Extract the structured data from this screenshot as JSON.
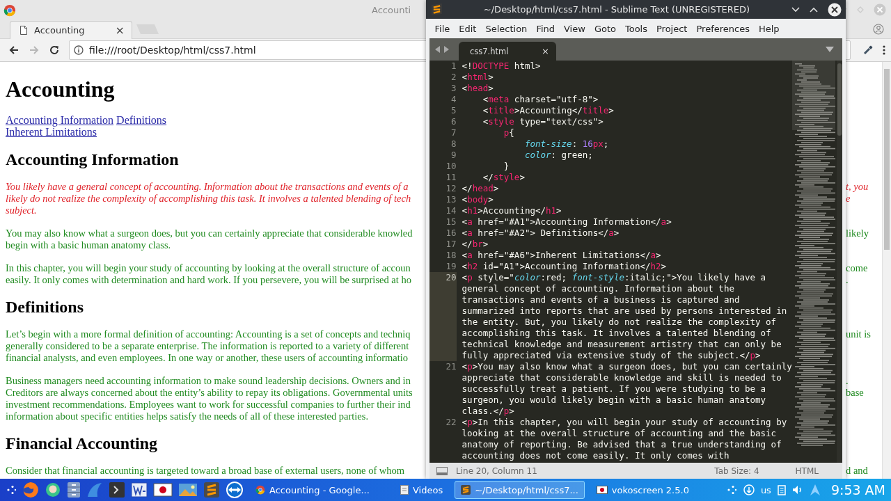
{
  "browser": {
    "window_title": "Accounti",
    "tab": {
      "label": "Accounting",
      "close": "×"
    },
    "nav": [
      {
        "kind": "back",
        "disabled": false
      },
      {
        "kind": "forward",
        "disabled": true
      },
      {
        "kind": "reload",
        "disabled": false
      }
    ],
    "address": "file:///root/Desktop/html/css7.html",
    "page": [
      {
        "kind": "h1",
        "lines": [
          {
            "left": "Accounting"
          }
        ]
      },
      {
        "kind": "links",
        "lines": [
          {
            "links": [
              "Accounting Information",
              "Definitions"
            ]
          },
          {
            "links": [
              "Inherent Limitations"
            ]
          }
        ]
      },
      {
        "kind": "h2",
        "lines": [
          {
            "left": "Accounting Information"
          }
        ]
      },
      {
        "kind": "p-red",
        "lines": [
          {
            "left": "You likely have a general concept of accounting. Information about the transactions and events of a",
            "right": "t, you"
          },
          {
            "left": "likely do not realize the complexity of accomplishing this task. It involves a talented blending of tech",
            "right": "e"
          },
          {
            "left": "subject."
          }
        ]
      },
      {
        "kind": "p-green",
        "lines": [
          {
            "left": "You may also know what a surgeon does, but you can certainly appreciate that considerable knowled",
            "right": "likely"
          },
          {
            "left": "begin with a basic human anatomy class."
          }
        ]
      },
      {
        "kind": "p-green",
        "lines": [
          {
            "left": "In this chapter, you will begin your study of accounting by looking at the overall structure of accoun",
            "right": "come"
          },
          {
            "left": "easily. It only comes with determination and hard work. If you persevere, you will be surprised at ho",
            "right": "."
          }
        ]
      },
      {
        "kind": "h2",
        "lines": [
          {
            "left": "Definitions"
          }
        ]
      },
      {
        "kind": "p-green",
        "lines": [
          {
            "left": "Let’s begin with a more formal definition of accounting: Accounting is a set of concepts and techniq",
            "right": "unit is"
          },
          {
            "left": "generally considered to be a separate enterprise. The information is reported to a variety of different"
          },
          {
            "left": "financial analysts, and even employees. In one way or another, these users of accounting informatio"
          }
        ]
      },
      {
        "kind": "p-green",
        "lines": [
          {
            "left": "Business managers need accounting information to make sound leadership decisions. Owners and in",
            "right": "."
          },
          {
            "left": "Creditors are always concerned about the entity’s ability to repay its obligations. Governmental units",
            "right": "base"
          },
          {
            "left": "investment recommendations. Employees want to work for successful companies to further their ind"
          },
          {
            "left": "information about specific entities helps satisfy the needs of all of these interested parties."
          }
        ]
      },
      {
        "kind": "h2",
        "lines": [
          {
            "left": "Financial Accounting"
          }
        ]
      },
      {
        "kind": "p-green",
        "lines": [
          {
            "left": "Consider that financial accounting is targeted toward a broad base of external users, none of whom",
            "right": "d and"
          }
        ]
      }
    ]
  },
  "editor": {
    "title": "~/Desktop/html/css7.html - Sublime Text (UNREGISTERED)",
    "menu": [
      "File",
      "Edit",
      "Selection",
      "Find",
      "View",
      "Goto",
      "Tools",
      "Project",
      "Preferences",
      "Help"
    ],
    "tab": {
      "label": "css7.html",
      "close": "×"
    },
    "lines": [
      {
        "number": "1",
        "current": false,
        "rows": [
          {
            "segments": [
              {
                "kind": "t",
                "text": "<!"
              },
              {
                "kind": "g",
                "text": "DOCTYPE"
              },
              {
                "kind": "t",
                "text": " html>"
              }
            ]
          }
        ]
      },
      {
        "number": "2",
        "current": false,
        "rows": [
          {
            "segments": [
              {
                "kind": "t",
                "text": "<"
              },
              {
                "kind": "g",
                "text": "html"
              },
              {
                "kind": "t",
                "text": ">"
              }
            ]
          }
        ]
      },
      {
        "number": "3",
        "current": false,
        "rows": [
          {
            "segments": [
              {
                "kind": "t",
                "text": "<"
              },
              {
                "kind": "g",
                "text": "head"
              },
              {
                "kind": "t",
                "text": ">"
              }
            ]
          }
        ]
      },
      {
        "number": "4",
        "current": false,
        "rows": [
          {
            "segments": [
              {
                "kind": "t",
                "text": "    <"
              },
              {
                "kind": "g",
                "text": "meta"
              },
              {
                "kind": "t",
                "text": " charset=\"utf-8\">"
              }
            ]
          }
        ]
      },
      {
        "number": "5",
        "current": false,
        "rows": [
          {
            "segments": [
              {
                "kind": "t",
                "text": "    <"
              },
              {
                "kind": "g",
                "text": "title"
              },
              {
                "kind": "t",
                "text": ">Accounting</"
              },
              {
                "kind": "g",
                "text": "title"
              },
              {
                "kind": "t",
                "text": ">"
              }
            ]
          }
        ]
      },
      {
        "number": "6",
        "current": false,
        "rows": [
          {
            "segments": [
              {
                "kind": "t",
                "text": "    <"
              },
              {
                "kind": "g",
                "text": "style"
              },
              {
                "kind": "t",
                "text": " type=\"text/css\">"
              }
            ]
          }
        ]
      },
      {
        "number": "7",
        "current": false,
        "rows": [
          {
            "segments": [
              {
                "kind": "g",
                "text": "        p"
              },
              {
                "kind": "t",
                "text": "{"
              }
            ]
          }
        ]
      },
      {
        "number": "8",
        "current": false,
        "rows": [
          {
            "segments": [
              {
                "kind": "i",
                "text": "            font-size"
              },
              {
                "kind": "t",
                "text": ": "
              },
              {
                "kind": "n",
                "text": "16"
              },
              {
                "kind": "g",
                "text": "px"
              },
              {
                "kind": "t",
                "text": ";"
              }
            ]
          }
        ]
      },
      {
        "number": "9",
        "current": false,
        "rows": [
          {
            "segments": [
              {
                "kind": "i",
                "text": "            color"
              },
              {
                "kind": "t",
                "text": ": green;"
              }
            ]
          }
        ]
      },
      {
        "number": "10",
        "current": false,
        "rows": [
          {
            "segments": [
              {
                "kind": "t",
                "text": "        }"
              }
            ]
          }
        ]
      },
      {
        "number": "11",
        "current": false,
        "rows": [
          {
            "segments": [
              {
                "kind": "t",
                "text": "    </"
              },
              {
                "kind": "g",
                "text": "style"
              },
              {
                "kind": "t",
                "text": ">"
              }
            ]
          }
        ]
      },
      {
        "number": "12",
        "current": false,
        "rows": [
          {
            "segments": [
              {
                "kind": "t",
                "text": "</"
              },
              {
                "kind": "g",
                "text": "head"
              },
              {
                "kind": "t",
                "text": ">"
              }
            ]
          }
        ]
      },
      {
        "number": "13",
        "current": false,
        "rows": [
          {
            "segments": [
              {
                "kind": "t",
                "text": "<"
              },
              {
                "kind": "g",
                "text": "body"
              },
              {
                "kind": "t",
                "text": ">"
              }
            ]
          }
        ]
      },
      {
        "number": "14",
        "current": false,
        "rows": [
          {
            "segments": [
              {
                "kind": "t",
                "text": "<"
              },
              {
                "kind": "g",
                "text": "h1"
              },
              {
                "kind": "t",
                "text": ">Accounting</"
              },
              {
                "kind": "g",
                "text": "h1"
              },
              {
                "kind": "t",
                "text": ">"
              }
            ]
          }
        ]
      },
      {
        "number": "15",
        "current": false,
        "rows": [
          {
            "segments": [
              {
                "kind": "t",
                "text": "<"
              },
              {
                "kind": "g",
                "text": "a"
              },
              {
                "kind": "t",
                "text": " href=\"#A1\">Accounting Information</"
              },
              {
                "kind": "g",
                "text": "a"
              },
              {
                "kind": "t",
                "text": ">"
              }
            ]
          }
        ]
      },
      {
        "number": "16",
        "current": false,
        "rows": [
          {
            "segments": [
              {
                "kind": "t",
                "text": "<"
              },
              {
                "kind": "g",
                "text": "a"
              },
              {
                "kind": "t",
                "text": " href=\"#A2\"> Definitions</"
              },
              {
                "kind": "g",
                "text": "a"
              },
              {
                "kind": "t",
                "text": ">"
              }
            ]
          }
        ]
      },
      {
        "number": "17",
        "current": false,
        "rows": [
          {
            "segments": [
              {
                "kind": "t",
                "text": "</"
              },
              {
                "kind": "g",
                "text": "br"
              },
              {
                "kind": "t",
                "text": ">"
              }
            ]
          }
        ]
      },
      {
        "number": "18",
        "current": false,
        "rows": [
          {
            "segments": [
              {
                "kind": "t",
                "text": "<"
              },
              {
                "kind": "g",
                "text": "a"
              },
              {
                "kind": "t",
                "text": " href=\"#A6\">Inherent Limitations</"
              },
              {
                "kind": "g",
                "text": "a"
              },
              {
                "kind": "t",
                "text": ">"
              }
            ]
          }
        ]
      },
      {
        "number": "19",
        "current": false,
        "rows": [
          {
            "segments": [
              {
                "kind": "t",
                "text": "<"
              },
              {
                "kind": "g",
                "text": "h2"
              },
              {
                "kind": "t",
                "text": " id=\"A1\">Accounting Information</"
              },
              {
                "kind": "g",
                "text": "h2"
              },
              {
                "kind": "t",
                "text": ">"
              }
            ]
          }
        ]
      },
      {
        "number": "20",
        "current": true,
        "rows": [
          {
            "segments": [
              {
                "kind": "t",
                "text": "<"
              },
              {
                "kind": "g",
                "text": "p"
              },
              {
                "kind": "t",
                "text": " style=\""
              },
              {
                "kind": "i",
                "text": "color"
              },
              {
                "kind": "t",
                "text": ":red; "
              },
              {
                "kind": "i",
                "text": "font-style"
              },
              {
                "kind": "t",
                "text": ":italic;\">You likely have a"
              }
            ]
          },
          {
            "segments": [
              {
                "kind": "t",
                "text": "general concept of accounting. Information about the"
              }
            ]
          },
          {
            "segments": [
              {
                "kind": "t",
                "text": "transactions and events of a business is captured and"
              }
            ]
          },
          {
            "segments": [
              {
                "kind": "t",
                "text": "summarized into reports that are used by persons interested in"
              }
            ]
          },
          {
            "segments": [
              {
                "kind": "t",
                "text": "the entity. But, you likely do not realize the complexity of"
              }
            ]
          },
          {
            "segments": [
              {
                "kind": "t",
                "text": "accomplishing this task. It involves a talented blending of"
              }
            ]
          },
          {
            "segments": [
              {
                "kind": "t",
                "text": "technical knowledge and measurement artistry that can only be"
              }
            ]
          },
          {
            "segments": [
              {
                "kind": "t",
                "text": "fully appreciated via extensive study of the subject.</"
              },
              {
                "kind": "g",
                "text": "p"
              },
              {
                "kind": "t",
                "text": ">"
              }
            ]
          }
        ]
      },
      {
        "number": "21",
        "current": false,
        "rows": [
          {
            "segments": [
              {
                "kind": "t",
                "text": "<"
              },
              {
                "kind": "g",
                "text": "p"
              },
              {
                "kind": "t",
                "text": ">You may also know what a surgeon does, but you can certainly"
              }
            ]
          },
          {
            "segments": [
              {
                "kind": "t",
                "text": "appreciate that considerable knowledge and skill is needed to"
              }
            ]
          },
          {
            "segments": [
              {
                "kind": "t",
                "text": "successfully treat a patient. If you were studying to be a"
              }
            ]
          },
          {
            "segments": [
              {
                "kind": "t",
                "text": "surgeon, you would likely begin with a basic human anatomy"
              }
            ]
          },
          {
            "segments": [
              {
                "kind": "t",
                "text": "class.</"
              },
              {
                "kind": "g",
                "text": "p"
              },
              {
                "kind": "t",
                "text": ">"
              }
            ]
          }
        ]
      },
      {
        "number": "22",
        "current": false,
        "rows": [
          {
            "segments": [
              {
                "kind": "t",
                "text": "<"
              },
              {
                "kind": "g",
                "text": "p"
              },
              {
                "kind": "t",
                "text": ">In this chapter, you will begin your study of accounting by"
              }
            ]
          },
          {
            "segments": [
              {
                "kind": "t",
                "text": "looking at the overall structure of accounting and the basic"
              }
            ]
          },
          {
            "segments": [
              {
                "kind": "t",
                "text": "anatomy of reporting. Be advised that a true understanding of"
              }
            ]
          },
          {
            "segments": [
              {
                "kind": "t",
                "text": "accounting does not come easily. It only comes with"
              }
            ]
          }
        ]
      }
    ],
    "status": {
      "position": "Line 20, Column 11",
      "tab_size": "Tab Size: 4",
      "syntax": "HTML"
    }
  },
  "taskbar": {
    "tasks": [
      {
        "kind": "browser",
        "label": "Accounting - Google...",
        "selected": false
      },
      {
        "kind": "folder",
        "label": "Videos",
        "selected": false
      },
      {
        "kind": "sublime",
        "label": "~/Desktop/html/css7...",
        "selected": true
      },
      {
        "kind": "recorder",
        "label": "vokoscreen 2.5.0",
        "selected": false
      }
    ],
    "layout": "us",
    "clock": "9:53 AM"
  }
}
